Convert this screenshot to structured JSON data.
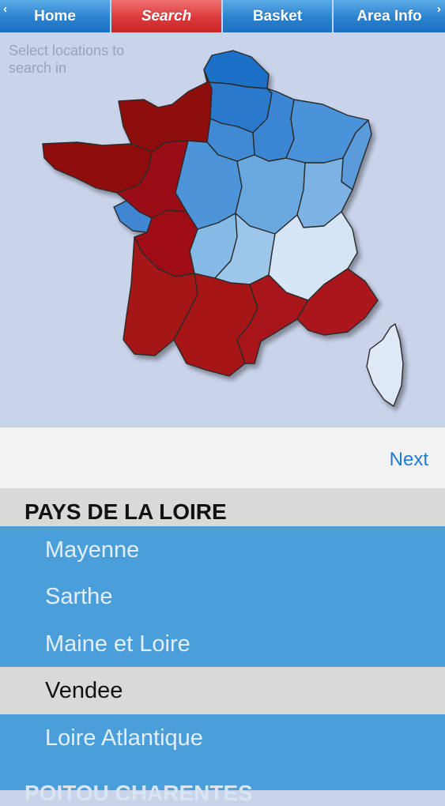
{
  "tabbar": {
    "tabs": [
      {
        "label": "Home",
        "active": false
      },
      {
        "label": "Search",
        "active": true
      },
      {
        "label": "Basket",
        "active": false
      },
      {
        "label": "Area Info",
        "active": false
      }
    ],
    "left_chevron": "‹",
    "right_chevron": "›"
  },
  "map": {
    "hint": "Select locations to search in",
    "colors": {
      "selected_region": "#a51418",
      "unselected_region_dark": "#2f7ed4",
      "unselected_region_light": "#e4ecf8",
      "background": "#c9d3ea"
    }
  },
  "next": {
    "label": "Next"
  },
  "list": {
    "section_header": "PAYS DE LA LOIRE",
    "items": [
      {
        "label": "Mayenne",
        "selected": false
      },
      {
        "label": "Sarthe",
        "selected": false
      },
      {
        "label": "Maine et Loire",
        "selected": false
      },
      {
        "label": "Vendee",
        "selected": true
      },
      {
        "label": "Loire Atlantique",
        "selected": false
      }
    ],
    "next_section_header_partial": "POITOU CHARENTES"
  }
}
